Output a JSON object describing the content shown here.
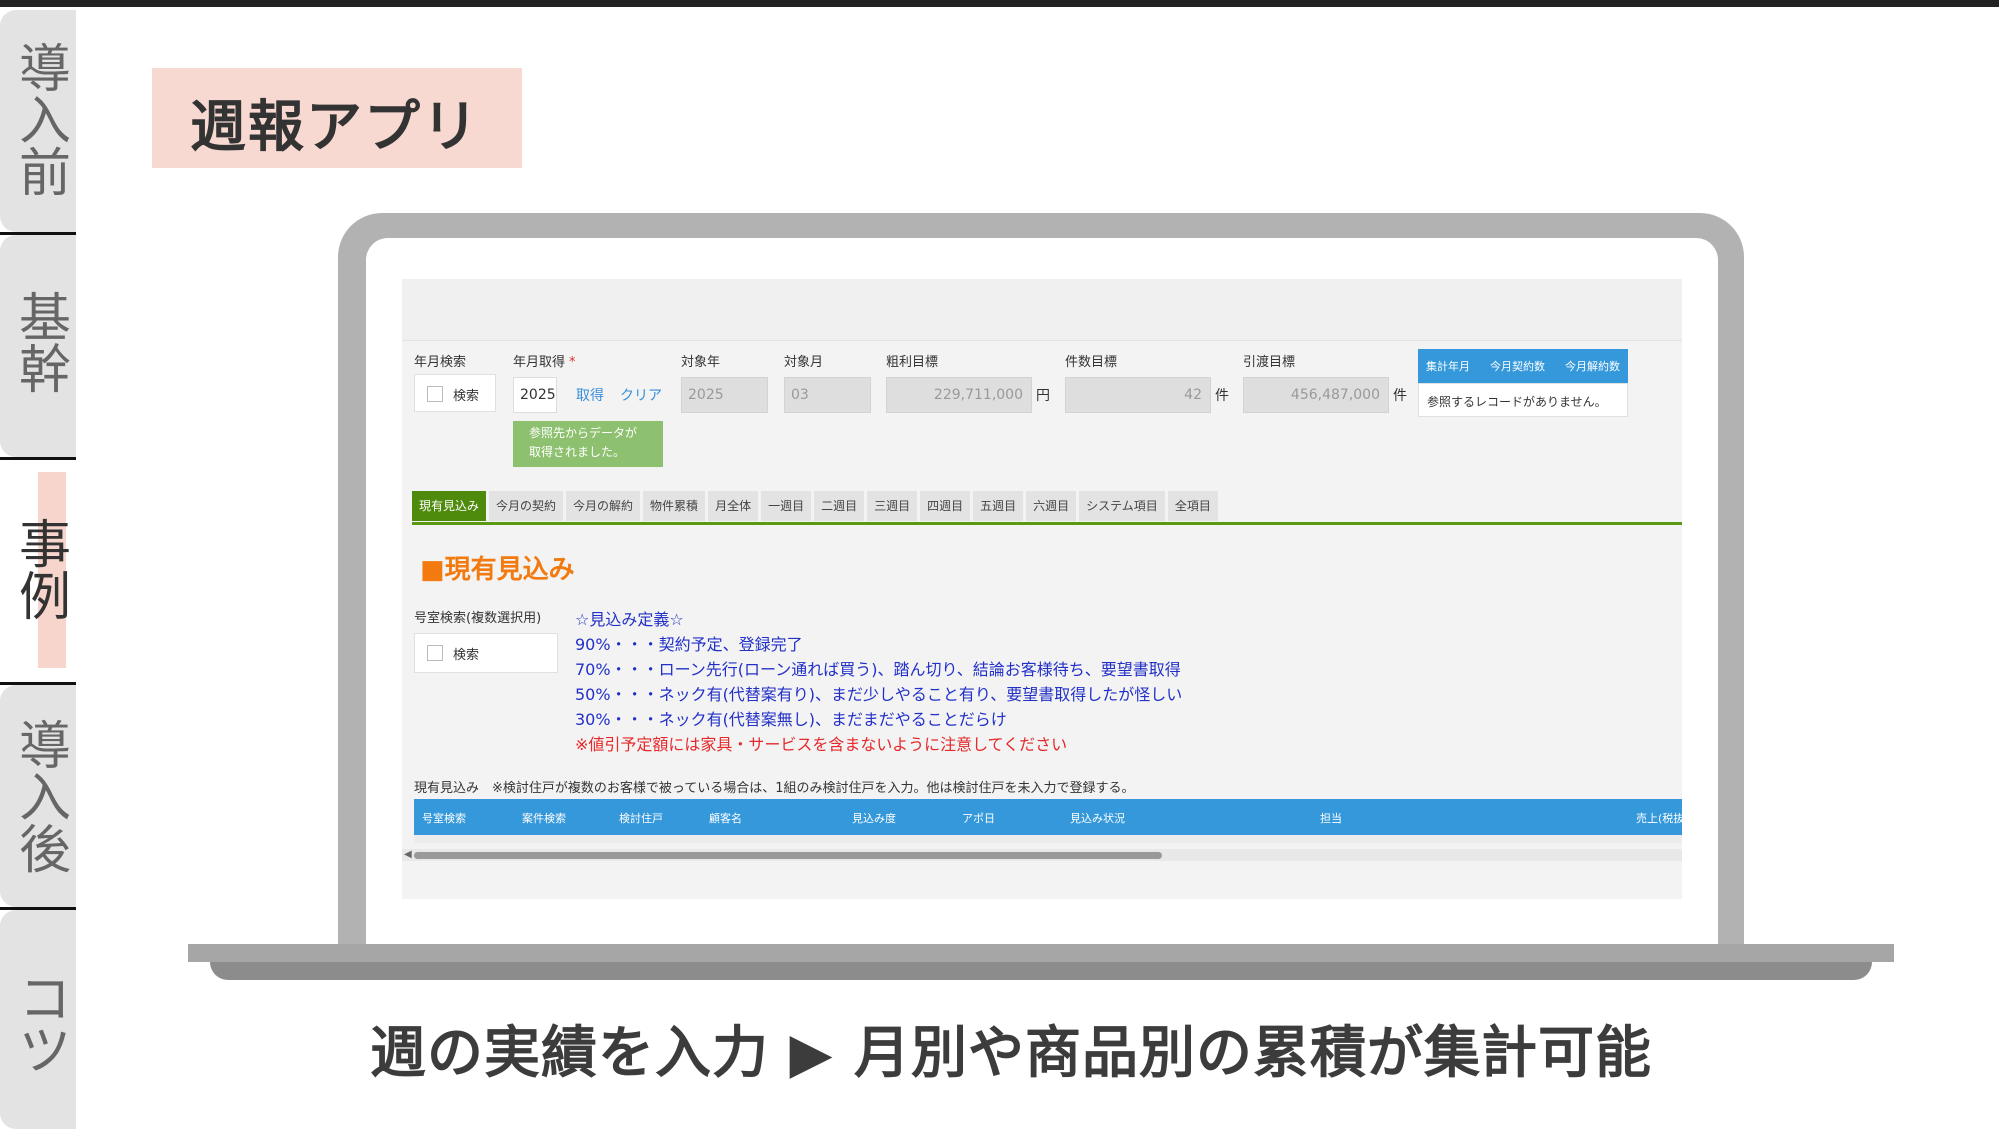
{
  "side_tabs": [
    "導入前",
    "基幹",
    "事例",
    "導入後",
    "コツ"
  ],
  "active_tab": "事例",
  "page_title": "週報アプリ",
  "form": {
    "ym_search_label": "年月検索",
    "ym_search_check": "検索",
    "ym_get_label": "年月取得",
    "required_mark": "*",
    "ym_get_value": "2025",
    "get_link": "取得",
    "clear_link": "クリア",
    "notice": "参照先からデータが取得されました。",
    "target_year_label": "対象年",
    "target_year_value": "2025",
    "target_month_label": "対象月",
    "target_month_value": "03",
    "gross_label": "粗利目標",
    "gross_value": "229,711,000",
    "gross_unit": "円",
    "count_label": "件数目標",
    "count_value": "42",
    "count_unit": "件",
    "handover_label": "引渡目標",
    "handover_value": "456,487,000",
    "handover_unit": "件"
  },
  "summary": {
    "headers": [
      "集計年月",
      "今月契約数",
      "今月解約数"
    ],
    "empty_text": "参照するレコードがありません。"
  },
  "tabs": [
    "現有見込み",
    "今月の契約",
    "今月の解約",
    "物件累積",
    "月全体",
    "一週目",
    "二週目",
    "三週目",
    "四週目",
    "五週目",
    "六週目",
    "システム項目",
    "全項目"
  ],
  "section_title": "■現有見込み",
  "room_search_label": "号室検索(複数選択用)",
  "room_search_check": "検索",
  "definitions": [
    "☆見込み定義☆",
    "90%・・・契約予定、登録完了",
    "70%・・・ローン先行(ローン通れば買う)、踏ん切り、結論お客様待ち、要望書取得",
    "50%・・・ネック有(代替案有り)、まだ少しやること有り、要望書取得したが怪しい",
    "30%・・・ネック有(代替案無し)、まだまだやることだらけ"
  ],
  "warning": "※値引予定額には家具・サービスを含まないように注意してください",
  "table_note": "現有見込み　※検討住戸が複数のお客様で被っている場合は、1組のみ検討住戸を入力。他は検討住戸を未入力で登録する。",
  "grid_columns": [
    "号室検索",
    "案件検索",
    "検討住戸",
    "顧客名",
    "見込み度",
    "アポ日",
    "見込み状況",
    "担当",
    "売上(税抜"
  ],
  "caption": "週の実績を入力 ▶ 月別や商品別の累積が集計可能"
}
